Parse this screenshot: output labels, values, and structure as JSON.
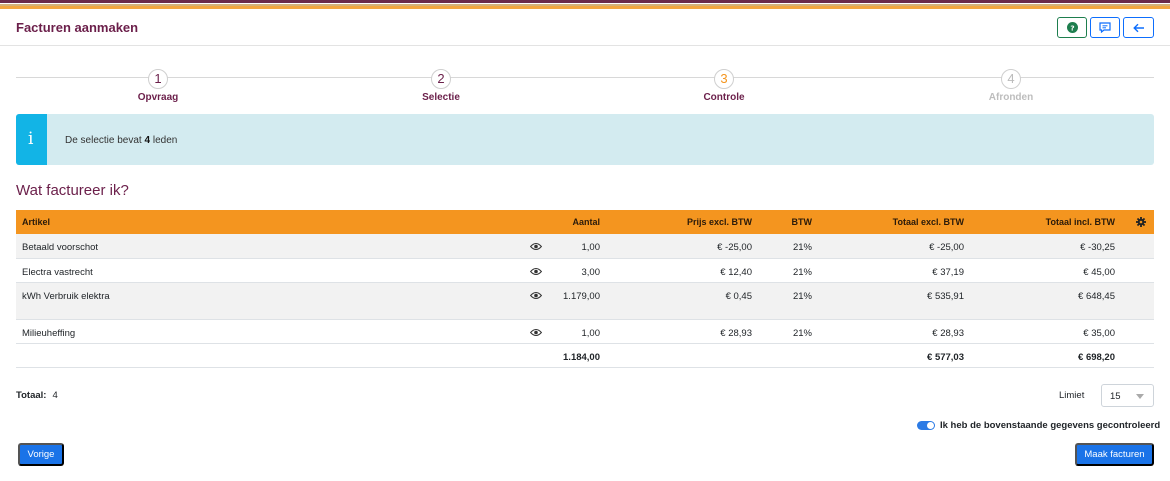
{
  "header": {
    "title": "Facturen aanmaken"
  },
  "steps": [
    {
      "number": "1",
      "label": "Opvraag",
      "state": "done"
    },
    {
      "number": "2",
      "label": "Selectie",
      "state": "done"
    },
    {
      "number": "3",
      "label": "Controle",
      "state": "active"
    },
    {
      "number": "4",
      "label": "Afronden",
      "state": "pending"
    }
  ],
  "info": {
    "prefix": "De selectie bevat",
    "count": "4",
    "suffix": "leden"
  },
  "section_title": "Wat factureer ik?",
  "table": {
    "columns": [
      "Artikel",
      "Aantal",
      "Prijs excl. BTW",
      "BTW",
      "Totaal excl. BTW",
      "Totaal incl. BTW"
    ],
    "rows": [
      {
        "artikel": "Betaald voorschot",
        "aantal": "1,00",
        "prijs": "€ -25,00",
        "btw": "21%",
        "totaal_excl": "€ -25,00",
        "totaal_incl": "€ -30,25"
      },
      {
        "artikel": "Electra vastrecht",
        "aantal": "3,00",
        "prijs": "€ 12,40",
        "btw": "21%",
        "totaal_excl": "€ 37,19",
        "totaal_incl": "€ 45,00"
      },
      {
        "artikel": "kWh Verbruik elektra",
        "aantal": "1.179,00",
        "prijs": "€ 0,45",
        "btw": "21%",
        "totaal_excl": "€ 535,91",
        "totaal_incl": "€ 648,45"
      },
      {
        "artikel": "Milieuheffing",
        "aantal": "1,00",
        "prijs": "€ 28,93",
        "btw": "21%",
        "totaal_excl": "€ 28,93",
        "totaal_incl": "€ 35,00"
      }
    ],
    "totals": {
      "aantal": "1.184,00",
      "totaal_excl": "€ 577,03",
      "totaal_incl": "€ 698,20"
    }
  },
  "footer": {
    "totaal_label": "Totaal:",
    "totaal_value": "4",
    "limiet_label": "Limiet",
    "limiet_value": "15",
    "confirm_label": "Ik heb de bovenstaande gegevens gecontroleerd",
    "prev_label": "Vorige",
    "submit_label": "Maak facturen"
  },
  "colors": {
    "accent": "#f4951f",
    "brand": "#6b1f4a",
    "primary": "#1a73e8",
    "info": "#12b4e6"
  }
}
